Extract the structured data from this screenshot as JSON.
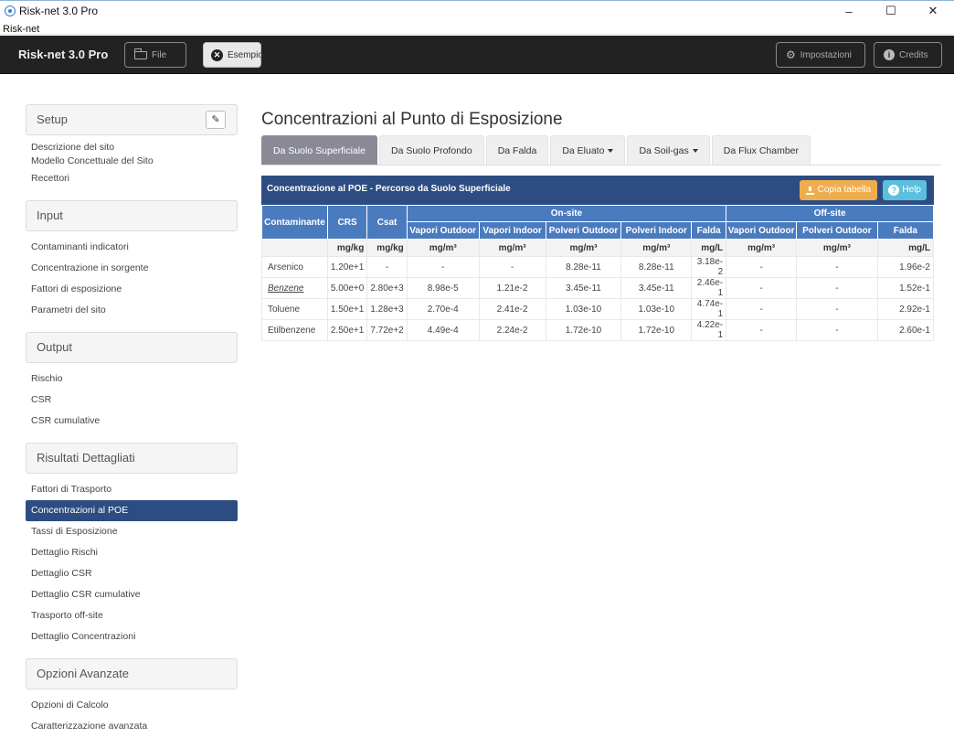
{
  "window": {
    "title": "Risk-net 3.0 Pro",
    "menu": "Risk-net",
    "controls": {
      "minimize": "–",
      "maximize": "☐",
      "close": "✕"
    }
  },
  "navbar": {
    "brand": "Risk-net 3.0 Pro",
    "file_label": "File",
    "example_label": "Esempio",
    "settings_label": "Impostazioni",
    "credits_label": "Credits"
  },
  "sidebar": {
    "setup": {
      "title": "Setup",
      "items": [
        "Descrizione del sito",
        "Modello Concettuale del Sito",
        "Recettori"
      ]
    },
    "input": {
      "title": "Input",
      "items": [
        "Contaminanti indicatori",
        "Concentrazione in sorgente",
        "Fattori di esposizione",
        "Parametri del sito"
      ]
    },
    "output": {
      "title": "Output",
      "items": [
        "Rischio",
        "CSR",
        "CSR cumulative"
      ]
    },
    "results": {
      "title": "Risultati Dettagliati",
      "items": [
        "Fattori di Trasporto",
        "Concentrazioni al POE",
        "Tassi di Esposizione",
        "Dettaglio Rischi",
        "Dettaglio CSR",
        "Dettaglio CSR cumulative",
        "Trasporto off-site",
        "Dettaglio Concentrazioni"
      ],
      "active_index": 1
    },
    "advanced": {
      "title": "Opzioni Avanzate",
      "items": [
        "Opzioni di Calcolo",
        "Caratterizzazione avanzata"
      ]
    }
  },
  "main": {
    "title": "Concentrazioni al Punto di Esposizione",
    "tabs": [
      "Da Suolo Superficiale",
      "Da Suolo Profondo",
      "Da Falda",
      "Da Eluato",
      "Da Soil-gas",
      "Da Flux Chamber"
    ],
    "panel_title": "Concentrazione al POE - Percorso da Suolo Superficiale",
    "copy_label": "Copia tabella",
    "help_label": "Help",
    "table": {
      "col_contaminant": "Contaminante",
      "col_crs": "CRS",
      "col_csat": "Csat",
      "group_onsite": "On-site",
      "group_offsite": "Off-site",
      "onsite_cols": [
        "Vapori Outdoor",
        "Vapori Indoor",
        "Polveri Outdoor",
        "Polveri Indoor",
        "Falda"
      ],
      "offsite_cols": [
        "Vapori Outdoor",
        "Polveri Outdoor",
        "Falda"
      ],
      "units": [
        "mg/kg",
        "mg/kg",
        "mg/m³",
        "mg/m³",
        "mg/m³",
        "mg/m³",
        "mg/L",
        "mg/m³",
        "mg/m³",
        "mg/L"
      ],
      "rows": [
        {
          "name": "Arsenico",
          "cells": [
            "1.20e+1",
            "-",
            "-",
            "-",
            "8.28e-11",
            "8.28e-11",
            "3.18e-2",
            "-",
            "-",
            "1.96e-2"
          ]
        },
        {
          "name": "Benzene",
          "cells": [
            "5.00e+0",
            "2.80e+3",
            "8.98e-5",
            "1.21e-2",
            "3.45e-11",
            "3.45e-11",
            "2.46e-1",
            "-",
            "-",
            "1.52e-1"
          ]
        },
        {
          "name": "Toluene",
          "cells": [
            "1.50e+1",
            "1.28e+3",
            "2.70e-4",
            "2.41e-2",
            "1.03e-10",
            "1.03e-10",
            "4.74e-1",
            "-",
            "-",
            "2.92e-1"
          ]
        },
        {
          "name": "Etilbenzene",
          "cells": [
            "2.50e+1",
            "7.72e+2",
            "4.49e-4",
            "2.24e-2",
            "1.72e-10",
            "1.72e-10",
            "4.22e-1",
            "-",
            "-",
            "2.60e-1"
          ]
        }
      ]
    }
  }
}
